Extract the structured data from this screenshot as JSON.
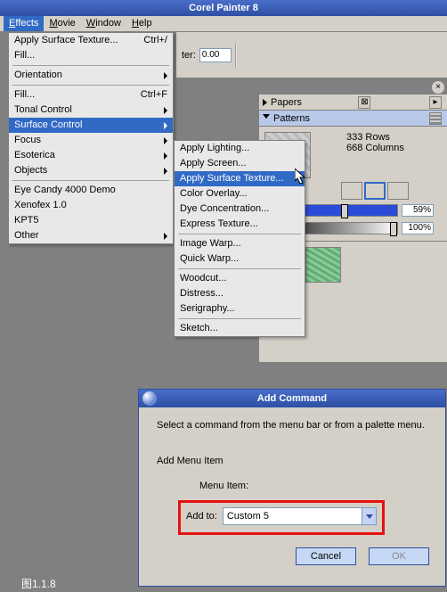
{
  "app": {
    "title": "Corel Painter 8"
  },
  "menubar": [
    {
      "label": "Effects",
      "hotkey": "E",
      "open": true
    },
    {
      "label": "Movie",
      "hotkey": "M"
    },
    {
      "label": "Window",
      "hotkey": "W"
    },
    {
      "label": "Help",
      "hotkey": "H"
    }
  ],
  "toolbar": {
    "field_label": "ter:",
    "field_value": "0.00"
  },
  "effects_menu": [
    {
      "label": "Apply Surface Texture...",
      "shortcut": "Ctrl+/",
      "type": "item"
    },
    {
      "label": "Fill...",
      "type": "item"
    },
    {
      "type": "sep"
    },
    {
      "label": "Orientation",
      "type": "submenu"
    },
    {
      "type": "sep"
    },
    {
      "label": "Fill...",
      "shortcut": "Ctrl+F",
      "type": "item"
    },
    {
      "label": "Tonal Control",
      "type": "submenu"
    },
    {
      "label": "Surface Control",
      "type": "submenu",
      "selected": true
    },
    {
      "label": "Focus",
      "type": "submenu"
    },
    {
      "label": "Esoterica",
      "type": "submenu"
    },
    {
      "label": "Objects",
      "type": "submenu"
    },
    {
      "type": "sep"
    },
    {
      "label": "Eye Candy 4000 Demo",
      "type": "item"
    },
    {
      "label": "Xenofex 1.0",
      "type": "item"
    },
    {
      "label": "KPT5",
      "type": "item"
    },
    {
      "label": "Other",
      "type": "submenu"
    }
  ],
  "surface_submenu": [
    {
      "label": "Apply Lighting..."
    },
    {
      "label": "Apply Screen..."
    },
    {
      "label": "Apply Surface Texture...",
      "selected": true
    },
    {
      "label": "Color Overlay..."
    },
    {
      "label": "Dye Concentration..."
    },
    {
      "label": "Express Texture..."
    },
    {
      "type": "sep"
    },
    {
      "label": "Image Warp..."
    },
    {
      "label": "Quick Warp..."
    },
    {
      "type": "sep"
    },
    {
      "label": "Woodcut..."
    },
    {
      "label": "Distress..."
    },
    {
      "label": "Serigraphy..."
    },
    {
      "type": "sep"
    },
    {
      "label": "Sketch..."
    }
  ],
  "palettes": {
    "papers": {
      "title": "Papers"
    },
    "patterns": {
      "title": "Patterns",
      "rows_label": "333 Rows",
      "cols_label": "668 Columns",
      "slider1": "59%",
      "slider2": "100%"
    }
  },
  "dialog": {
    "title": "Add Command",
    "instruction": "Select a command from the menu bar or from a palette menu.",
    "add_label": "Add Menu Item",
    "menu_item_label": "Menu Item:",
    "add_to_label": "Add to:",
    "combo_value": "Custom  5",
    "cancel": "Cancel",
    "ok": "OK"
  },
  "caption": "图1.1.8"
}
